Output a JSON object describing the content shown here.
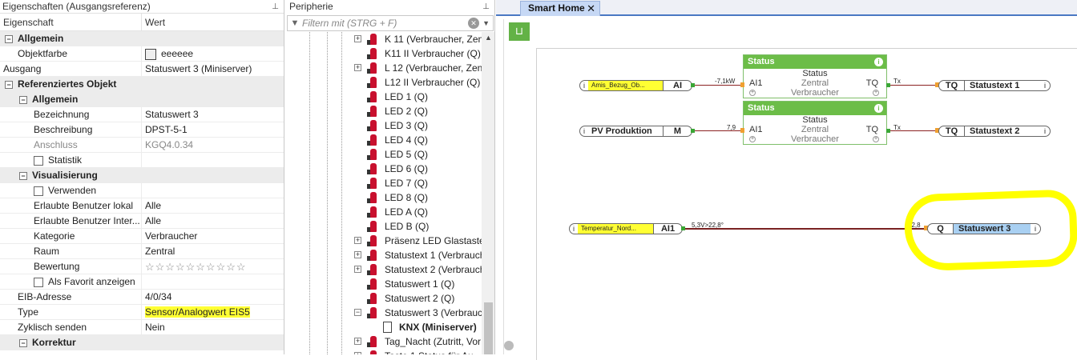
{
  "properties": {
    "title": "Eigenschaften (Ausgangsreferenz)",
    "col_property": "Eigenschaft",
    "col_value": "Wert",
    "rows": {
      "allgemein": "Allgemein",
      "objektfarbe_k": "Objektfarbe",
      "objektfarbe_v": "eeeeee",
      "ausgang_k": "Ausgang",
      "ausgang_v": "Statuswert 3 (Miniserver)",
      "ref_obj": "Referenziertes Objekt",
      "allgemein2": "Allgemein",
      "bez_k": "Bezeichnung",
      "bez_v": "Statuswert 3",
      "beschr_k": "Beschreibung",
      "beschr_v": "DPST-5-1",
      "anschl_k": "Anschluss",
      "anschl_v": "KGQ4.0.34",
      "statistik": "Statistik",
      "visual": "Visualisierung",
      "verwenden": "Verwenden",
      "ebl_k": "Erlaubte Benutzer lokal",
      "ebl_v": "Alle",
      "ebi_k": "Erlaubte Benutzer Inter...",
      "ebi_v": "Alle",
      "kat_k": "Kategorie",
      "kat_v": "Verbraucher",
      "raum_k": "Raum",
      "raum_v": "Zentral",
      "bew_k": "Bewertung",
      "bew_v": "☆☆☆☆☆☆☆☆☆☆",
      "fav": "Als Favorit anzeigen",
      "eib_k": "EIB-Adresse",
      "eib_v": "4/0/34",
      "type_k": "Type",
      "type_v": "Sensor/Analogwert EIS5",
      "zyk_k": "Zyklisch senden",
      "zyk_v": "Nein",
      "korr": "Korrektur"
    }
  },
  "peripherie": {
    "title": "Peripherie",
    "filter_placeholder": "Filtern mit (STRG + F)",
    "items": [
      "K 11 (Verbraucher, Zentral)",
      "K11 II Verbraucher (Q)",
      "L 12 (Verbraucher, Zentral)",
      "L12 II Verbraucher (Q)",
      "LED 1 (Q)",
      "LED 2 (Q)",
      "LED 3 (Q)",
      "LED 4 (Q)",
      "LED 5 (Q)",
      "LED 6 (Q)",
      "LED 7 (Q)",
      "LED 8 (Q)",
      "LED A (Q)",
      "LED B (Q)",
      "Präsenz LED Glastaster",
      "Statustext 1 (Verbraucher)",
      "Statustext 2 (Verbraucher)",
      "Statuswert 1 (Q)",
      "Statuswert 2 (Q)",
      "Statuswert 3 (Verbraucher)",
      "KNX (Miniserver)",
      "Tag_Nacht (Zutritt, Vor",
      "Taste 1 Status für Au"
    ]
  },
  "canvas": {
    "tab_label": "Smart Home",
    "tab_close": "✕",
    "pin_glyph": "⊔",
    "blocks": {
      "amis": {
        "name": "Amis_Bezug_Ob...",
        "port": "AI"
      },
      "pv": {
        "name": "PV Produktion",
        "port": "M"
      },
      "temp": {
        "name": "Temperatur_Nord...",
        "port": "AI1"
      },
      "status1": {
        "title": "Status",
        "row1": "Status",
        "ai": "AI1",
        "center": "Zentral",
        "tq": "TQ",
        "row3": "Verbraucher"
      },
      "status2": {
        "title": "Status",
        "row1": "Status",
        "ai": "AI1",
        "center": "Zentral",
        "tq": "TQ",
        "row3": "Verbraucher"
      },
      "out1": {
        "port": "TQ",
        "name": "Statustext 1"
      },
      "out2": {
        "port": "TQ",
        "name": "Statustext 2"
      },
      "out3": {
        "port": "Q",
        "name": "Statuswert 3"
      }
    },
    "wire_labels": {
      "w1": "-7,1kW",
      "w1tx": "Tx",
      "w2": "7,9",
      "w2tx": "Tx",
      "w3": "5,3V>22,8°",
      "w3in": "22,8"
    }
  }
}
